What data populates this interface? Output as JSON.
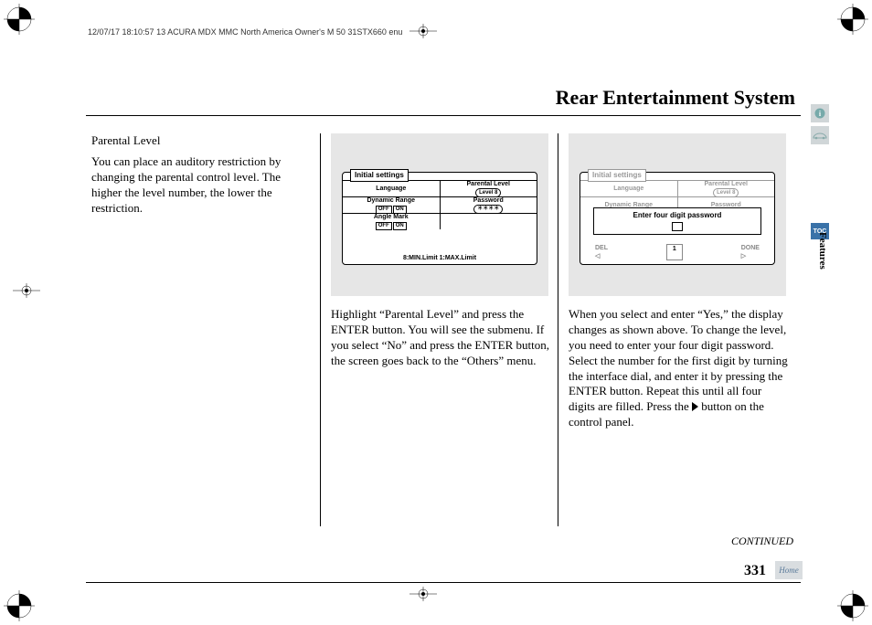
{
  "meta": {
    "header": "12/07/17 18:10:57   13 ACURA MDX MMC North America Owner's M 50 31STX660 enu"
  },
  "page": {
    "title": "Rear Entertainment System",
    "continued": "CONTINUED",
    "number": "331"
  },
  "sidebar": {
    "toc": "TOC",
    "section": "Features",
    "home": "Home"
  },
  "col1": {
    "heading": "Parental Level",
    "body": "You can place an auditory restriction by changing the parental control level. The higher the level number, the lower the restriction."
  },
  "fig1": {
    "header": "Initial settings",
    "language": "Language",
    "parental": "Parental Level",
    "level": "Level 8",
    "dynamic": "Dynamic Range",
    "password": "Password",
    "stars": "＊＊＊＊",
    "off": "OFF",
    "on": "ON",
    "angle": "Angle Mark",
    "footer": "8:MIN.Limit 1:MAX.Limit"
  },
  "col2": {
    "body": "Highlight “Parental Level” and press the ENTER button. You will see the submenu. If you select “No” and press the ENTER button, the screen goes back to the “Others” menu."
  },
  "fig2": {
    "header": "Initial settings",
    "language": "Language",
    "parental": "Parental Level",
    "level": "Level 8",
    "dynamic": "Dynamic Range",
    "password": "Password",
    "overlay": "Enter four digit password",
    "del": "DEL",
    "num": "1",
    "done": "DONE"
  },
  "col3": {
    "body_a": "When you select and enter “Yes,” the display changes as shown above. To change the level, you need to enter your four digit password. Select the number for the first digit by turning the interface dial, and enter it by pressing the ENTER button. Repeat this until all four digits are filled. Press the ",
    "body_b": " button on the control panel."
  }
}
